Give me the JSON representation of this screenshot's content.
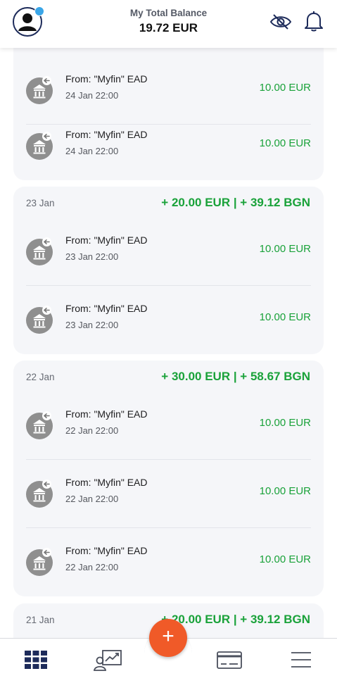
{
  "header": {
    "title": "My Total Balance",
    "balance": "19.72 EUR"
  },
  "groups": [
    {
      "date": "",
      "total": "",
      "transactions": [
        {
          "from": "From: \"Myfin\"  EAD",
          "time": "24 Jan 22:00",
          "amount": "10.00 EUR"
        },
        {
          "from": "From: \"Myfin\"  EAD",
          "time": "24 Jan 22:00",
          "amount": "10.00 EUR"
        }
      ]
    },
    {
      "date": "23 Jan",
      "total": "+ 20.00 EUR | + 39.12 BGN",
      "transactions": [
        {
          "from": "From: \"Myfin\"  EAD",
          "time": "23 Jan 22:00",
          "amount": "10.00 EUR"
        },
        {
          "from": "From: \"Myfin\"  EAD",
          "time": "23 Jan 22:00",
          "amount": "10.00 EUR"
        }
      ]
    },
    {
      "date": "22 Jan",
      "total": "+ 30.00 EUR | + 58.67 BGN",
      "transactions": [
        {
          "from": "From: \"Myfin\"  EAD",
          "time": "22 Jan 22:00",
          "amount": "10.00 EUR"
        },
        {
          "from": "From: \"Myfin\"  EAD",
          "time": "22 Jan 22:00",
          "amount": "10.00 EUR"
        },
        {
          "from": "From: \"Myfin\"  EAD",
          "time": "22 Jan 22:00",
          "amount": "10.00 EUR"
        }
      ]
    },
    {
      "date": "21 Jan",
      "total": "+ 20.00 EUR | + 39.12 BGN",
      "transactions": []
    }
  ],
  "nav": {
    "items": [
      "grid-icon",
      "investments-icon",
      "add-icon",
      "card-icon",
      "menu-icon"
    ],
    "fab_label": "+"
  },
  "colors": {
    "accent": "#f05a28",
    "positive": "#1aa23a",
    "navy": "#1d2b5a"
  }
}
